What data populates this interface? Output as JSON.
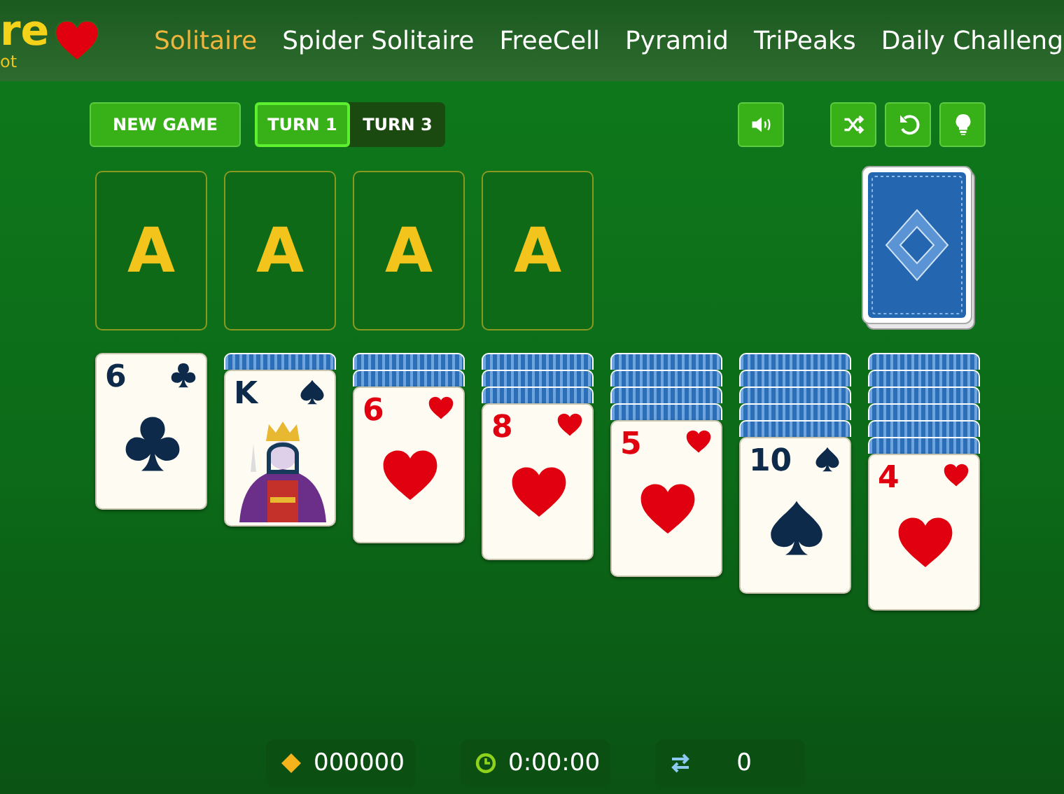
{
  "logo": {
    "title": "re",
    "tagline": "ot"
  },
  "nav": [
    {
      "label": "Solitaire",
      "selected": true
    },
    {
      "label": "Spider Solitaire",
      "selected": false
    },
    {
      "label": "FreeCell",
      "selected": false
    },
    {
      "label": "Pyramid",
      "selected": false
    },
    {
      "label": "TriPeaks",
      "selected": false
    },
    {
      "label": "Daily Challeng",
      "selected": false
    }
  ],
  "toolbar": {
    "new_game": "NEW GAME",
    "turn_options": [
      {
        "label": "TURN 1",
        "selected": true
      },
      {
        "label": "TURN 3",
        "selected": false
      }
    ],
    "icon_buttons": [
      {
        "kind": "sound"
      },
      {
        "kind": "shuffle"
      },
      {
        "kind": "undo"
      },
      {
        "kind": "hint"
      }
    ]
  },
  "foundations": [
    {
      "label": "A"
    },
    {
      "label": "A"
    },
    {
      "label": "A"
    },
    {
      "label": "A"
    }
  ],
  "tableau": [
    {
      "card": {
        "rank": "6",
        "kind": "clubs",
        "court": false
      }
    },
    {
      "hidden": [
        {
          "kind": "back"
        }
      ],
      "card": {
        "rank": "K",
        "kind": "spades",
        "court": true
      }
    },
    {
      "hidden": [
        {
          "kind": "back"
        },
        {
          "kind": "back"
        }
      ],
      "card": {
        "rank": "6",
        "kind": "hearts",
        "court": false
      }
    },
    {
      "hidden": [
        {
          "kind": "back"
        },
        {
          "kind": "back"
        },
        {
          "kind": "back"
        }
      ],
      "card": {
        "rank": "8",
        "kind": "hearts",
        "court": false
      }
    },
    {
      "hidden": [
        {
          "kind": "back"
        },
        {
          "kind": "back"
        },
        {
          "kind": "back"
        },
        {
          "kind": "back"
        }
      ],
      "card": {
        "rank": "5",
        "kind": "hearts",
        "court": false
      }
    },
    {
      "hidden": [
        {
          "kind": "back"
        },
        {
          "kind": "back"
        },
        {
          "kind": "back"
        },
        {
          "kind": "back"
        },
        {
          "kind": "back"
        }
      ],
      "card": {
        "rank": "10",
        "kind": "spades",
        "court": false
      }
    },
    {
      "hidden": [
        {
          "kind": "back"
        },
        {
          "kind": "back"
        },
        {
          "kind": "back"
        },
        {
          "kind": "back"
        },
        {
          "kind": "back"
        },
        {
          "kind": "back"
        }
      ],
      "card": {
        "rank": "4",
        "kind": "hearts",
        "court": false
      }
    }
  ],
  "status": [
    {
      "kind": "score",
      "value": "000000"
    },
    {
      "kind": "time",
      "value": "0:00:00"
    },
    {
      "kind": "moves",
      "value": "0"
    }
  ]
}
